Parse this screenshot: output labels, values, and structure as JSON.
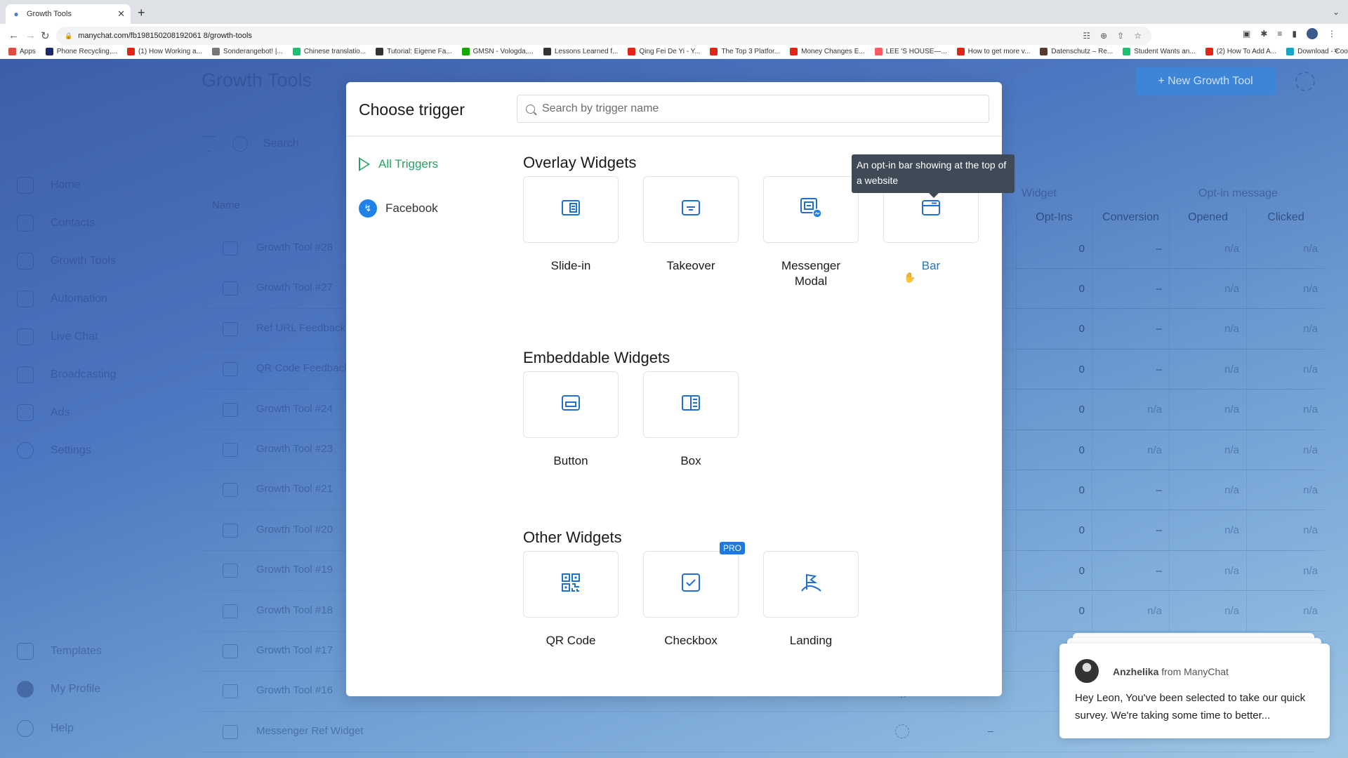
{
  "browser": {
    "tab_title": "Growth Tools",
    "url": "manychat.com/fb198150208192061 8/growth-tools",
    "bookmarks": [
      {
        "label": "Apps",
        "icon": "apps-grid-icon",
        "color": "#e04b3f"
      },
      {
        "label": "Phone Recycling,...",
        "icon": "o2-icon",
        "color": "#1a2a6c"
      },
      {
        "label": "(1) How Working a...",
        "icon": "youtube-icon",
        "color": "#e62117"
      },
      {
        "label": "Sonderangebot! |...",
        "icon": "check-circle-icon",
        "color": "#777777"
      },
      {
        "label": "Chinese translatio...",
        "icon": "fiverr-icon",
        "color": "#1dbf73"
      },
      {
        "label": "Tutorial: Eigene Fa...",
        "icon": "hash-icon",
        "color": "#333333"
      },
      {
        "label": "GMSN - Vologda,...",
        "icon": "upwork-icon",
        "color": "#14a800"
      },
      {
        "label": "Lessons Learned f...",
        "icon": "er-icon",
        "color": "#333333"
      },
      {
        "label": "Qing Fei De Yi - Y...",
        "icon": "youtube-icon",
        "color": "#e62117"
      },
      {
        "label": "The Top 3 Platfor...",
        "icon": "youtube-icon",
        "color": "#e62117"
      },
      {
        "label": "Money Changes E...",
        "icon": "youtube-icon",
        "color": "#e62117"
      },
      {
        "label": "LEE 'S HOUSE—...",
        "icon": "airbnb-icon",
        "color": "#ff5a5f"
      },
      {
        "label": "How to get more v...",
        "icon": "youtube-icon",
        "color": "#e62117"
      },
      {
        "label": "Datenschutz – Re...",
        "icon": "image-icon",
        "color": "#5a3a2a"
      },
      {
        "label": "Student Wants an...",
        "icon": "t-circle-icon",
        "color": "#1dbf73"
      },
      {
        "label": "(2) How To Add A...",
        "icon": "youtube-icon",
        "color": "#e62117"
      },
      {
        "label": "Download - Cooki...",
        "icon": "c-circle-icon",
        "color": "#1aa3c8"
      }
    ]
  },
  "app": {
    "page_title": "Growth Tools",
    "search_placeholder": "Search",
    "new_tool_button": "+ New Growth Tool",
    "sidebar": {
      "top_items": [
        {
          "label": "Home",
          "icon": "home-icon"
        },
        {
          "label": "Contacts",
          "icon": "contacts-icon"
        },
        {
          "label": "Growth Tools",
          "icon": "growth-tools-icon"
        },
        {
          "label": "Automation",
          "icon": "automation-icon"
        },
        {
          "label": "Live Chat",
          "icon": "chat-icon"
        },
        {
          "label": "Broadcasting",
          "icon": "broadcast-icon"
        },
        {
          "label": "Ads",
          "icon": "ads-icon"
        },
        {
          "label": "Settings",
          "icon": "gear-icon"
        }
      ],
      "bottom_items": [
        {
          "label": "Templates",
          "icon": "templates-icon"
        },
        {
          "label": "My Profile",
          "icon": "avatar-icon"
        },
        {
          "label": "Help",
          "icon": "help-icon"
        }
      ]
    },
    "table": {
      "name_header": "Name",
      "group_headers": {
        "widget": "Widget",
        "optin": "Opt-in message"
      },
      "columns": [
        "Opt-Ins",
        "Conversion",
        "Opened",
        "Clicked"
      ],
      "rows": [
        {
          "name": "Growth Tool #28",
          "icon": "qr-code-icon",
          "optins": "0",
          "conversion": "–",
          "opened": "n/a",
          "clicked": "n/a"
        },
        {
          "name": "Growth Tool #27",
          "icon": "qr-code-icon",
          "optins": "0",
          "conversion": "–",
          "opened": "n/a",
          "clicked": "n/a"
        },
        {
          "name": "Ref URL Feedback",
          "icon": "link-icon",
          "optins": "0",
          "conversion": "–",
          "opened": "n/a",
          "clicked": "n/a"
        },
        {
          "name": "QR Code Feedback",
          "icon": "qr-code-icon",
          "optins": "0",
          "conversion": "–",
          "opened": "n/a",
          "clicked": "n/a"
        },
        {
          "name": "Growth Tool #24",
          "icon": "landing-icon",
          "optins": "0",
          "conversion": "n/a",
          "opened": "n/a",
          "clicked": "n/a"
        },
        {
          "name": "Growth Tool #23",
          "icon": "takeover-icon",
          "optins": "0",
          "conversion": "n/a",
          "opened": "n/a",
          "clicked": "n/a"
        },
        {
          "name": "Growth Tool #21",
          "icon": "qr-code-icon",
          "optins": "0",
          "conversion": "–",
          "opened": "n/a",
          "clicked": "n/a"
        },
        {
          "name": "Growth Tool #20",
          "icon": "qr-code-icon",
          "optins": "0",
          "conversion": "–",
          "opened": "n/a",
          "clicked": "n/a"
        },
        {
          "name": "Growth Tool #19",
          "icon": "qr-code-icon",
          "optins": "0",
          "conversion": "–",
          "opened": "n/a",
          "clicked": "n/a"
        },
        {
          "name": "Growth Tool #18",
          "icon": "box-icon",
          "optins": "0",
          "conversion": "n/a",
          "opened": "n/a",
          "clicked": "n/a"
        },
        {
          "name": "Growth Tool #17",
          "icon": "messenger-icon",
          "optins": "",
          "conversion": "",
          "opened": "",
          "clicked": ""
        },
        {
          "name": "Growth Tool #16",
          "icon": "link-icon",
          "optins": "",
          "conversion": "",
          "opened": "",
          "clicked": ""
        },
        {
          "name": "Messenger Ref Widget",
          "icon": "link-icon",
          "optins": "–",
          "conversion": "",
          "opened": "",
          "clicked": ""
        }
      ]
    }
  },
  "modal": {
    "title": "Choose trigger",
    "search_placeholder": "Search by trigger name",
    "search_value": "",
    "nav": [
      {
        "label": "All Triggers",
        "icon": "play-icon",
        "active": true
      },
      {
        "label": "Facebook",
        "icon": "messenger-icon",
        "active": false
      }
    ],
    "accent_color": "#27a263",
    "sections": [
      {
        "title": "Overlay Widgets",
        "items": [
          {
            "label": "Slide-in",
            "icon": "slide-in-icon"
          },
          {
            "label": "Takeover",
            "icon": "takeover-icon"
          },
          {
            "label": "Messenger Modal",
            "icon": "messenger-modal-icon"
          },
          {
            "label": "Bar",
            "icon": "bar-icon",
            "hovered": true
          }
        ]
      },
      {
        "title": "Embeddable Widgets",
        "items": [
          {
            "label": "Button",
            "icon": "button-icon"
          },
          {
            "label": "Box",
            "icon": "box-icon"
          }
        ]
      },
      {
        "title": "Other Widgets",
        "items": [
          {
            "label": "QR Code",
            "icon": "qr-code-icon"
          },
          {
            "label": "Checkbox",
            "icon": "checkbox-icon",
            "badge": "PRO"
          },
          {
            "label": "Landing",
            "icon": "landing-icon"
          }
        ]
      }
    ],
    "tooltip": "An opt-in bar showing at the top of a website"
  },
  "chat_popup": {
    "sender_name": "Anzhelika",
    "sender_suffix": "from ManyChat",
    "message": "Hey Leon,  You've been selected to take our quick survey. We're taking some time to better..."
  }
}
